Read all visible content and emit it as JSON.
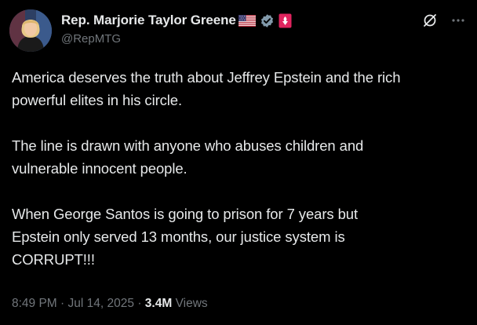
{
  "author": {
    "display_name": "Rep. Marjorie Taylor Greene",
    "handle": "@RepMTG",
    "avatar_icon": "profile-photo",
    "verified_color": "#829aab",
    "affiliate_color": "#e0245e"
  },
  "tweet": {
    "paragraphs": [
      "America deserves the truth about Jeffrey Epstein and the rich\npowerful elites in his circle.",
      "The line is drawn with anyone who abuses children and\nvulnerable innocent people.",
      "When George Santos is going to prison for 7 years but\nEpstein only served 13 months, our justice system is\nCORRUPT!!!"
    ]
  },
  "meta": {
    "time": "8:49 PM",
    "date": "Jul 14, 2025",
    "separator": "·",
    "views_count": "3.4M",
    "views_label": "Views"
  },
  "colors": {
    "background": "#000000",
    "primary_text": "#e7e9ea",
    "secondary_text": "#71767b"
  }
}
